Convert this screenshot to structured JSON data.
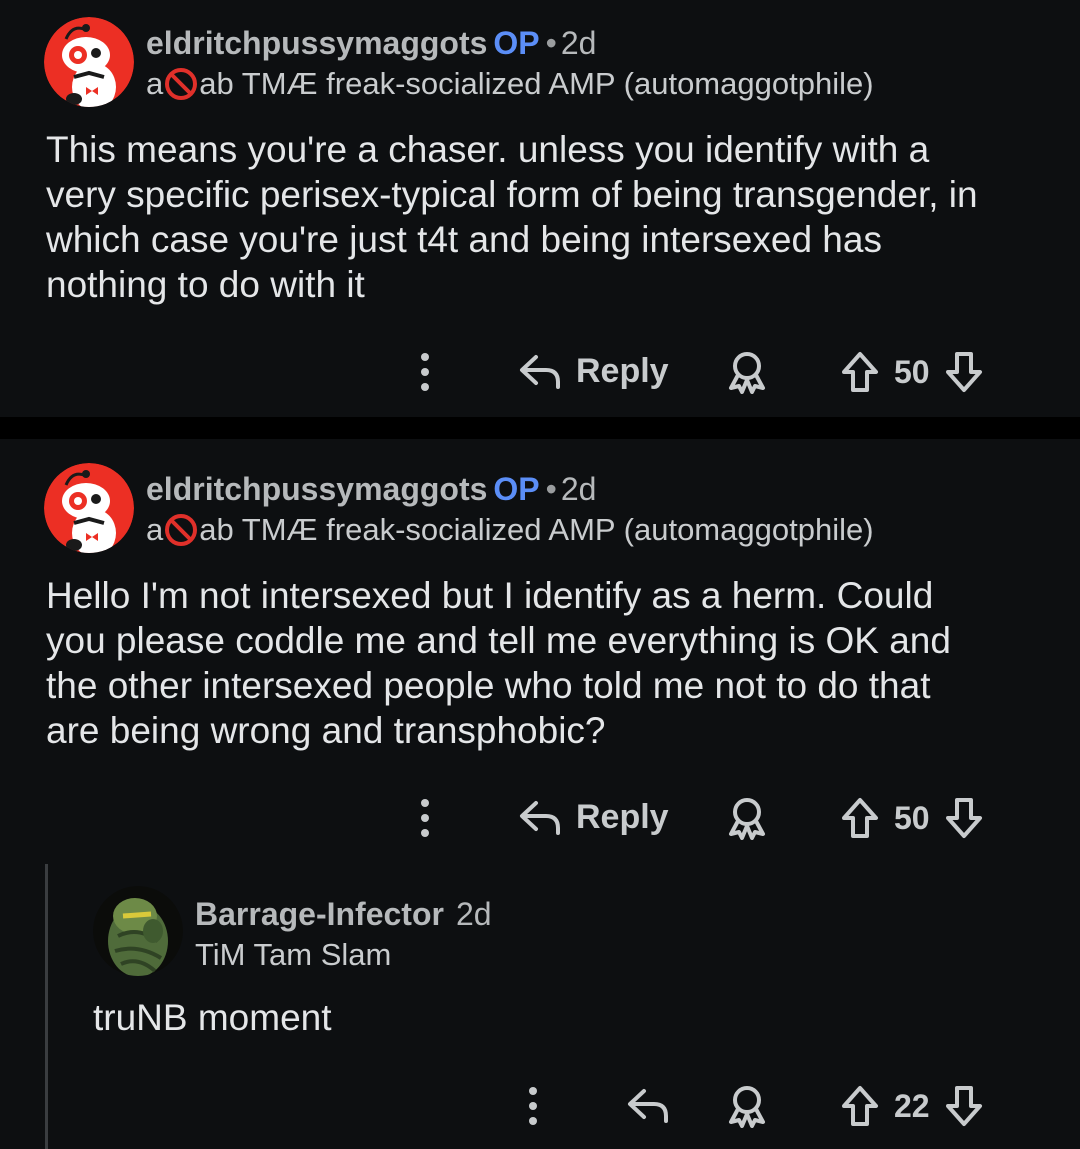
{
  "comments": [
    {
      "username": "eldritchpussymaggots",
      "op_badge": "OP",
      "separator": "•",
      "age": "2d",
      "flair_prefix": "a",
      "flair_suffix": "ab TMÆ freak-socialized AMP (automaggotphile)",
      "body_lines": [
        "This means you're a chaser. unless you identify with a",
        "very specific perisex-typical form of being transgender, in",
        "which case you're just t4t and being intersexed has",
        "nothing to do with it"
      ],
      "reply_label": "Reply",
      "score": "50"
    },
    {
      "username": "eldritchpussymaggots",
      "op_badge": "OP",
      "separator": "•",
      "age": "2d",
      "flair_prefix": "a",
      "flair_suffix": "ab TMÆ freak-socialized AMP (automaggotphile)",
      "body_lines": [
        "Hello I'm not intersexed but I identify as a herm. Could",
        "you please coddle me and tell me everything is OK and",
        "the other intersexed people who told me not to do that",
        "are being wrong and transphobic?"
      ],
      "reply_label": "Reply",
      "score": "50"
    },
    {
      "username": "Barrage-Infector",
      "age": "2d",
      "flair": "TiM Tam Slam",
      "body_lines": [
        "truNB moment"
      ],
      "score": "22"
    }
  ],
  "colors": {
    "background": "#0d0f11",
    "op_badge": "#5b8ef7",
    "avatar_red": "#ec2f24",
    "prohibited_icon": "#e0302a"
  },
  "icons": {
    "more": "vertical-dots-icon",
    "reply": "reply-arrow-icon",
    "award": "award-icon",
    "upvote": "upvote-arrow-icon",
    "downvote": "downvote-arrow-icon",
    "flair_symbol": "prohibited-icon"
  }
}
